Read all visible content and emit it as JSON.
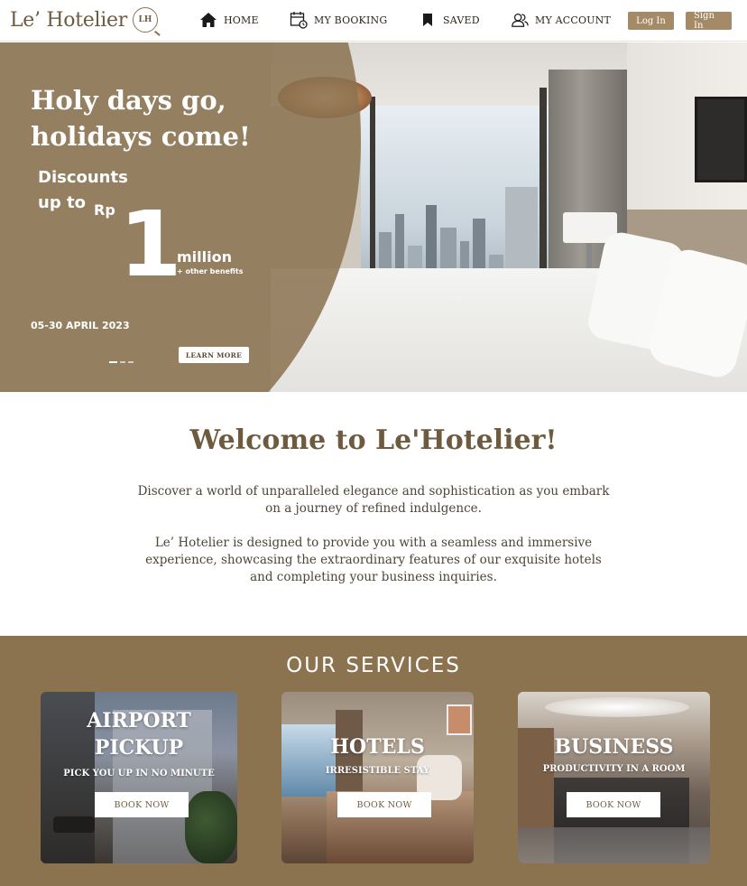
{
  "brand": {
    "name": "Le’ Hotelier",
    "mark": "LH"
  },
  "nav": {
    "items": [
      {
        "label": "HOME",
        "icon": "home-icon"
      },
      {
        "label": "MY BOOKING",
        "icon": "calendar-icon"
      },
      {
        "label": "SAVED",
        "icon": "bookmark-icon"
      },
      {
        "label": "MY ACCOUNT",
        "icon": "users-icon"
      }
    ],
    "login": "Log In",
    "signin": "Sign In"
  },
  "hero": {
    "title": "Holy days go, holidays come!",
    "discount_line": "Discounts up to",
    "currency": "Rp",
    "amount": "1",
    "unit": "million",
    "benefits": "+ other benefits",
    "dates": "05-30 APRIL 2023",
    "cta": "LEARN MORE",
    "slides": 3,
    "active_slide": 1
  },
  "welcome": {
    "title": "Welcome to Le'Hotelier!",
    "para1": "Discover a world of unparalleled elegance and sophistication as you embark on a journey of refined indulgence.",
    "para2": "Le’ Hotelier is designed to provide you with a seamless and immersive experience, showcasing the extraordinary features of our exquisite hotels and completing your business inquiries."
  },
  "services": {
    "title": "OUR SERVICES",
    "cards": [
      {
        "title_line1": "AIRPORT",
        "title_line2": "PICKUP",
        "subtitle": "PICK YOU UP IN NO MINUTE",
        "button": "BOOK NOW"
      },
      {
        "title_line1": "HOTELS",
        "title_line2": "",
        "subtitle": "IRRESISTIBLE STAY",
        "button": "BOOK NOW"
      },
      {
        "title_line1": "BUSINESS",
        "title_line2": "",
        "subtitle": "PRODUCTIVITY IN A ROOM",
        "button": "BOOK NOW"
      }
    ]
  },
  "colors": {
    "brand": "#8b7350",
    "button": "#a48a66",
    "text_dark": "#6e5b3f"
  }
}
